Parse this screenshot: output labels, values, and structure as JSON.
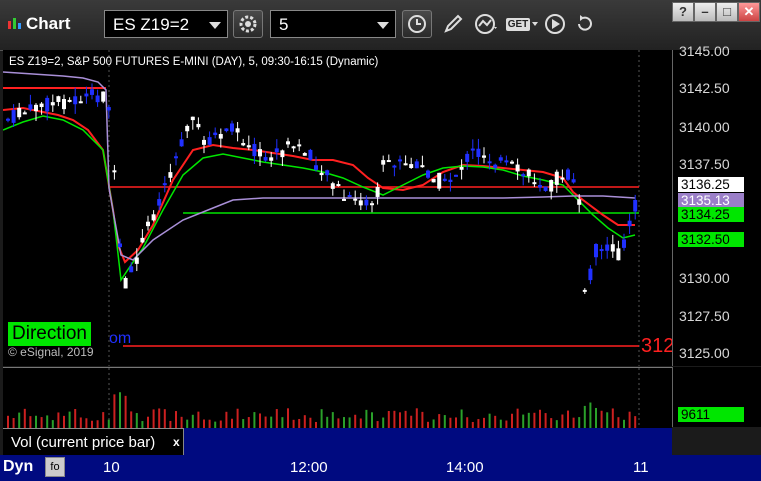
{
  "toolbar": {
    "title": "Chart",
    "symbol": "ES Z19=2",
    "interval": "5",
    "get_label": "GET",
    "window_buttons": [
      "?",
      "–",
      "□",
      "✕"
    ]
  },
  "chart": {
    "header": "ES Z19=2, S&P 500 FUTURES E-MINI (DAY), 5, 09:30-16:15 (Dynamic)",
    "direction_label": "Direction",
    "copyright": "© eSignal, 2019",
    "bottom_right_label": "312",
    "direction_tail": "om"
  },
  "price_axis": {
    "ticks": [
      "3145.00",
      "3142.50",
      "3140.00",
      "3137.50",
      "3135.00",
      "3132.50",
      "3130.00",
      "3127.50",
      "3125.00"
    ],
    "labels": [
      {
        "text": "3136.25",
        "bg": "#ffffff",
        "fg": "#000000"
      },
      {
        "text": "3135.13",
        "bg": "#9b7fc8",
        "fg": "#ffffff"
      },
      {
        "text": "3134.25",
        "bg": "#00e600",
        "fg": "#000000"
      },
      {
        "text": "3132.50",
        "bg": "#00e600",
        "fg": "#000000"
      }
    ]
  },
  "volume": {
    "legend": "Vol (current price bar)",
    "close": "x",
    "value": "9611"
  },
  "time_axis": {
    "dyn": "Dyn",
    "labels": [
      "10",
      "12:00",
      "14:00",
      "11"
    ]
  },
  "colors": {
    "up_candle": "#ffffff",
    "down_candle": "#2030ff",
    "red_line": "#ff2020",
    "green_line": "#00e600",
    "purple_line": "#a98fd8",
    "volume_bar": "#cc2020"
  }
}
